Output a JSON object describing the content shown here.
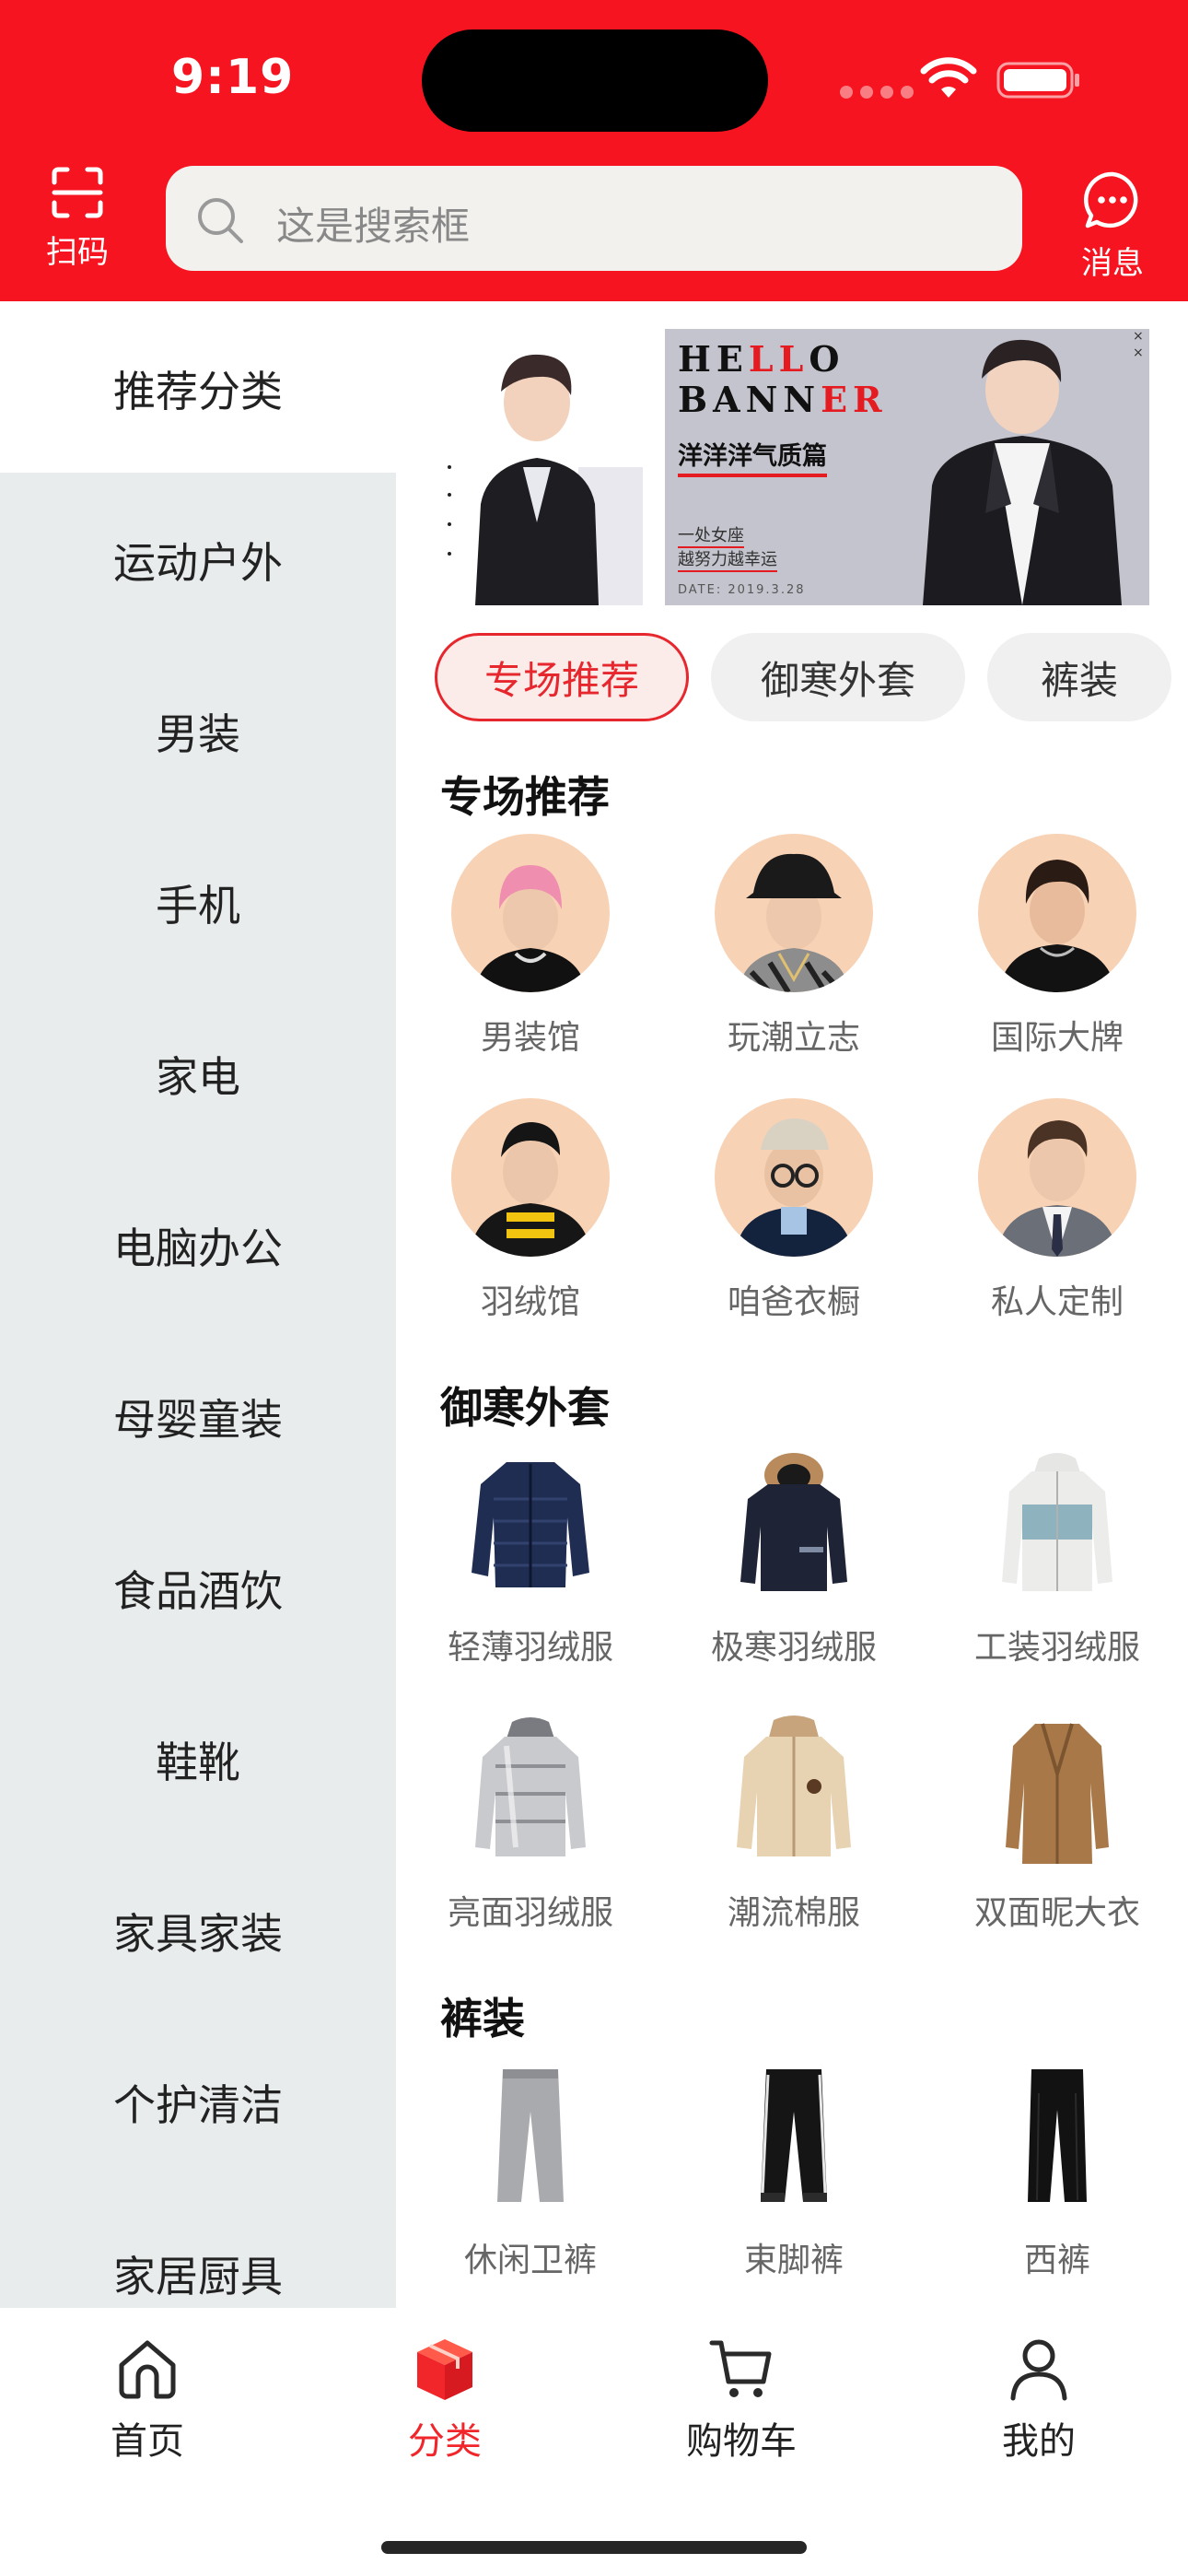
{
  "status_bar": {
    "time": "9:19"
  },
  "header": {
    "scan_label": "扫码",
    "search_placeholder": "这是搜索框",
    "message_label": "消息",
    "brand_color": "#f5141f"
  },
  "sidebar": {
    "active_index": 0,
    "items": [
      "推荐分类",
      "运动户外",
      "男装",
      "手机",
      "家电",
      "电脑办公",
      "母婴童装",
      "食品酒饮",
      "鞋靴",
      "家具家装",
      "个护清洁",
      "家居厨具"
    ]
  },
  "banner": {
    "line1": "HELLO",
    "line2": "BANNER",
    "subtitle": "洋洋洋气质篇",
    "small1": "一处女座",
    "small2": "越努力越幸运",
    "date": "DATE: 2019.3.28"
  },
  "chips": {
    "items": [
      "专场推荐",
      "御寒外套",
      "裤装"
    ],
    "active_index": 0
  },
  "sections": [
    {
      "title": "专场推荐",
      "items": [
        "男装馆",
        "玩潮立志",
        "国际大牌",
        "羽绒馆",
        "咱爸衣橱",
        "私人定制"
      ]
    },
    {
      "title": "御寒外套",
      "items": [
        "轻薄羽绒服",
        "极寒羽绒服",
        "工装羽绒服",
        "亮面羽绒服",
        "潮流棉服",
        "双面昵大衣"
      ]
    },
    {
      "title": "裤装",
      "items": [
        "休闲卫裤",
        "束脚裤",
        "西裤"
      ]
    }
  ],
  "tabbar": {
    "items": [
      {
        "label": "首页",
        "icon": "home-icon"
      },
      {
        "label": "分类",
        "icon": "category-cube-icon"
      },
      {
        "label": "购物车",
        "icon": "cart-icon"
      },
      {
        "label": "我的",
        "icon": "user-icon"
      }
    ],
    "active_index": 1,
    "active_color": "#f0262b"
  }
}
